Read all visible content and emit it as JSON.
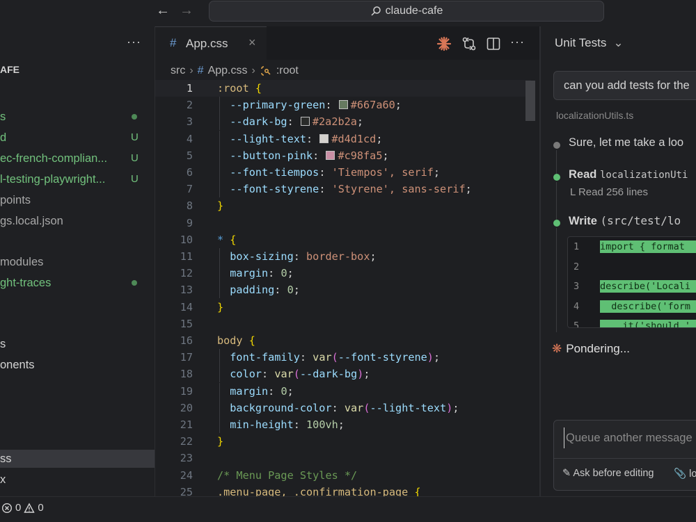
{
  "titlebar": {
    "search_text": "claude-cafe"
  },
  "sidebar": {
    "root_label": "AFE",
    "items": [
      {
        "label": "s",
        "color": "green",
        "mark": "dot",
        "badge": ""
      },
      {
        "label": "d",
        "color": "green",
        "mark": "badge",
        "badge": "U"
      },
      {
        "label": "ec-french-complian...",
        "color": "green",
        "mark": "badge",
        "badge": "U"
      },
      {
        "label": "l-testing-playwright...",
        "color": "green",
        "mark": "badge",
        "badge": "U"
      },
      {
        "label": "points",
        "color": "gray",
        "mark": "",
        "badge": ""
      },
      {
        "label": "gs.local.json",
        "color": "gray",
        "mark": "",
        "badge": ""
      },
      {
        "label": "modules",
        "color": "gray",
        "mark": "",
        "badge": ""
      },
      {
        "label": "ght-traces",
        "color": "green",
        "mark": "dot",
        "badge": ""
      },
      {
        "label": "s",
        "color": "white",
        "mark": "",
        "badge": ""
      },
      {
        "label": "onents",
        "color": "white",
        "mark": "",
        "badge": ""
      },
      {
        "label": "ss",
        "color": "white",
        "mark": "",
        "badge": "",
        "active": true
      },
      {
        "label": "x",
        "color": "white",
        "mark": "",
        "badge": ""
      }
    ]
  },
  "editor": {
    "tab": {
      "label": "App.css"
    },
    "breadcrumb": {
      "folder": "src",
      "file": "App.css",
      "symbol": ":root"
    },
    "current_line": 1
  },
  "code_lines": [
    [
      [
        "tk-sel",
        ":root "
      ],
      [
        "tk-brace",
        "{"
      ]
    ],
    [
      [
        "tk-prop",
        "  --primary-green"
      ],
      [
        "tk-punc",
        ": "
      ],
      [
        "swatch",
        "#667a60"
      ],
      [
        "tk-val",
        "#667a60"
      ],
      [
        "tk-punc",
        ";"
      ]
    ],
    [
      [
        "tk-prop",
        "  --dark-bg"
      ],
      [
        "tk-punc",
        ": "
      ],
      [
        "swatch",
        "#2a2b2a"
      ],
      [
        "tk-val",
        "#2a2b2a"
      ],
      [
        "tk-punc",
        ";"
      ]
    ],
    [
      [
        "tk-prop",
        "  --light-text"
      ],
      [
        "tk-punc",
        ": "
      ],
      [
        "swatch",
        "#d4d1cd"
      ],
      [
        "tk-val",
        "#d4d1cd"
      ],
      [
        "tk-punc",
        ";"
      ]
    ],
    [
      [
        "tk-prop",
        "  --button-pink"
      ],
      [
        "tk-punc",
        ": "
      ],
      [
        "swatch",
        "#c98fa5"
      ],
      [
        "tk-val",
        "#c98fa5"
      ],
      [
        "tk-punc",
        ";"
      ]
    ],
    [
      [
        "tk-prop",
        "  --font-tiempos"
      ],
      [
        "tk-punc",
        ": "
      ],
      [
        "tk-val",
        "'Tiempos', serif"
      ],
      [
        "tk-punc",
        ";"
      ]
    ],
    [
      [
        "tk-prop",
        "  --font-styrene"
      ],
      [
        "tk-punc",
        ": "
      ],
      [
        "tk-val",
        "'Styrene', sans-serif"
      ],
      [
        "tk-punc",
        ";"
      ]
    ],
    [
      [
        "tk-brace",
        "}"
      ]
    ],
    [],
    [
      [
        "tk-star",
        "* "
      ],
      [
        "tk-brace",
        "{"
      ]
    ],
    [
      [
        "tk-prop",
        "  box-sizing"
      ],
      [
        "tk-punc",
        ": "
      ],
      [
        "tk-val",
        "border-box"
      ],
      [
        "tk-punc",
        ";"
      ]
    ],
    [
      [
        "tk-prop",
        "  margin"
      ],
      [
        "tk-punc",
        ": "
      ],
      [
        "tk-num",
        "0"
      ],
      [
        "tk-punc",
        ";"
      ]
    ],
    [
      [
        "tk-prop",
        "  padding"
      ],
      [
        "tk-punc",
        ": "
      ],
      [
        "tk-num",
        "0"
      ],
      [
        "tk-punc",
        ";"
      ]
    ],
    [
      [
        "tk-brace",
        "}"
      ]
    ],
    [],
    [
      [
        "tk-sel",
        "body "
      ],
      [
        "tk-brace",
        "{"
      ]
    ],
    [
      [
        "tk-prop",
        "  font-family"
      ],
      [
        "tk-punc",
        ": "
      ],
      [
        "tk-fn",
        "var"
      ],
      [
        "tk-paren",
        "("
      ],
      [
        "tk-var",
        "--font-styrene"
      ],
      [
        "tk-paren",
        ")"
      ],
      [
        "tk-punc",
        ";"
      ]
    ],
    [
      [
        "tk-prop",
        "  color"
      ],
      [
        "tk-punc",
        ": "
      ],
      [
        "tk-fn",
        "var"
      ],
      [
        "tk-paren",
        "("
      ],
      [
        "tk-var",
        "--dark-bg"
      ],
      [
        "tk-paren",
        ")"
      ],
      [
        "tk-punc",
        ";"
      ]
    ],
    [
      [
        "tk-prop",
        "  margin"
      ],
      [
        "tk-punc",
        ": "
      ],
      [
        "tk-num",
        "0"
      ],
      [
        "tk-punc",
        ";"
      ]
    ],
    [
      [
        "tk-prop",
        "  background-color"
      ],
      [
        "tk-punc",
        ": "
      ],
      [
        "tk-fn",
        "var"
      ],
      [
        "tk-paren",
        "("
      ],
      [
        "tk-var",
        "--light-text"
      ],
      [
        "tk-paren",
        ")"
      ],
      [
        "tk-punc",
        ";"
      ]
    ],
    [
      [
        "tk-prop",
        "  min-height"
      ],
      [
        "tk-punc",
        ": "
      ],
      [
        "tk-num",
        "100vh"
      ],
      [
        "tk-punc",
        ";"
      ]
    ],
    [
      [
        "tk-brace",
        "}"
      ]
    ],
    [],
    [
      [
        "tk-comment",
        "/* Menu Page Styles */"
      ]
    ],
    [
      [
        "tk-sel",
        ".menu-page, .confirmation-page "
      ],
      [
        "tk-brace",
        "{"
      ]
    ]
  ],
  "chat": {
    "header_title": "Unit Tests",
    "user_message": "can you add tests for the",
    "user_attachment": "localizationUtils.ts",
    "reply_text": "Sure, let me take a loo",
    "read_label": "Read",
    "read_file": "localizationUti",
    "read_result": "L  Read 256 lines",
    "write_label": "Write",
    "write_file": "(src/test/lo",
    "diff_lines": [
      {
        "n": "1",
        "text": "import { format"
      },
      {
        "n": "2",
        "text": ""
      },
      {
        "n": "3",
        "text": "describe('Locali"
      },
      {
        "n": "4",
        "text": "  describe('form"
      },
      {
        "n": "5",
        "text": "    it('should '"
      }
    ],
    "status_text": "Pondering...",
    "composer_placeholder": "Queue another message",
    "ask_label": "Ask before editing",
    "attach_label": "lo"
  },
  "statusbar": {
    "errors": "0",
    "warnings": "0"
  }
}
